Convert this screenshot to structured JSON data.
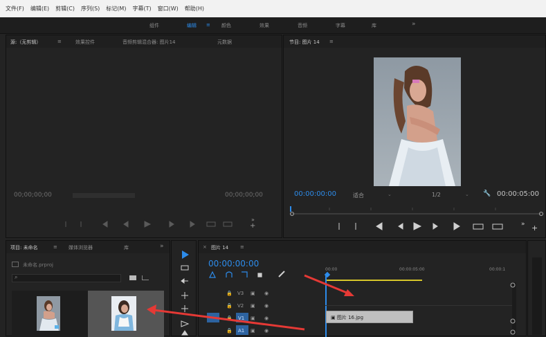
{
  "menu": [
    "文件(F)",
    "编辑(E)",
    "剪辑(C)",
    "序列(S)",
    "标记(M)",
    "字幕(T)",
    "窗口(W)",
    "帮助(H)"
  ],
  "workspaces": [
    "组件",
    "编辑",
    "颜色",
    "效果",
    "音频",
    "字幕",
    "库",
    "»"
  ],
  "active_workspace_marker": "≡",
  "source_panel": {
    "tabs": [
      "源:（无剪辑）",
      "≡",
      "效果控件",
      "音频剪辑混合器: 图片14",
      "元数据"
    ],
    "tc_left": "00;00;00;00",
    "tc_right": "00;00;00;00",
    "plus": "+",
    "more": "»"
  },
  "program_panel": {
    "tab": "节目: 图片 14",
    "tab_menu": "≡",
    "timecode": "00:00:00:00",
    "fit": "适合",
    "resolution": "1/2",
    "duration": "00:00:05:00",
    "wrench": "🔧",
    "plus": "+",
    "more": "»"
  },
  "project_panel": {
    "tabs": [
      "项目: 未命名",
      "≡",
      "媒体浏览器",
      "库",
      "»"
    ],
    "project_file": "未命名.prproj"
  },
  "timeline_panel": {
    "tab": "图片 14",
    "tab_menu": "≡",
    "close": "×",
    "timecode": "00:00:00:00",
    "ruler": [
      "00:00",
      "00:00:05:00",
      "00:00:1"
    ],
    "tracks": [
      "V3",
      "V2",
      "V1",
      "A1"
    ],
    "clip": "图片 16.jpg"
  },
  "colors": {
    "accent": "#2d8ceb",
    "arrow": "#e53935",
    "yellow": "#d8c72a"
  }
}
